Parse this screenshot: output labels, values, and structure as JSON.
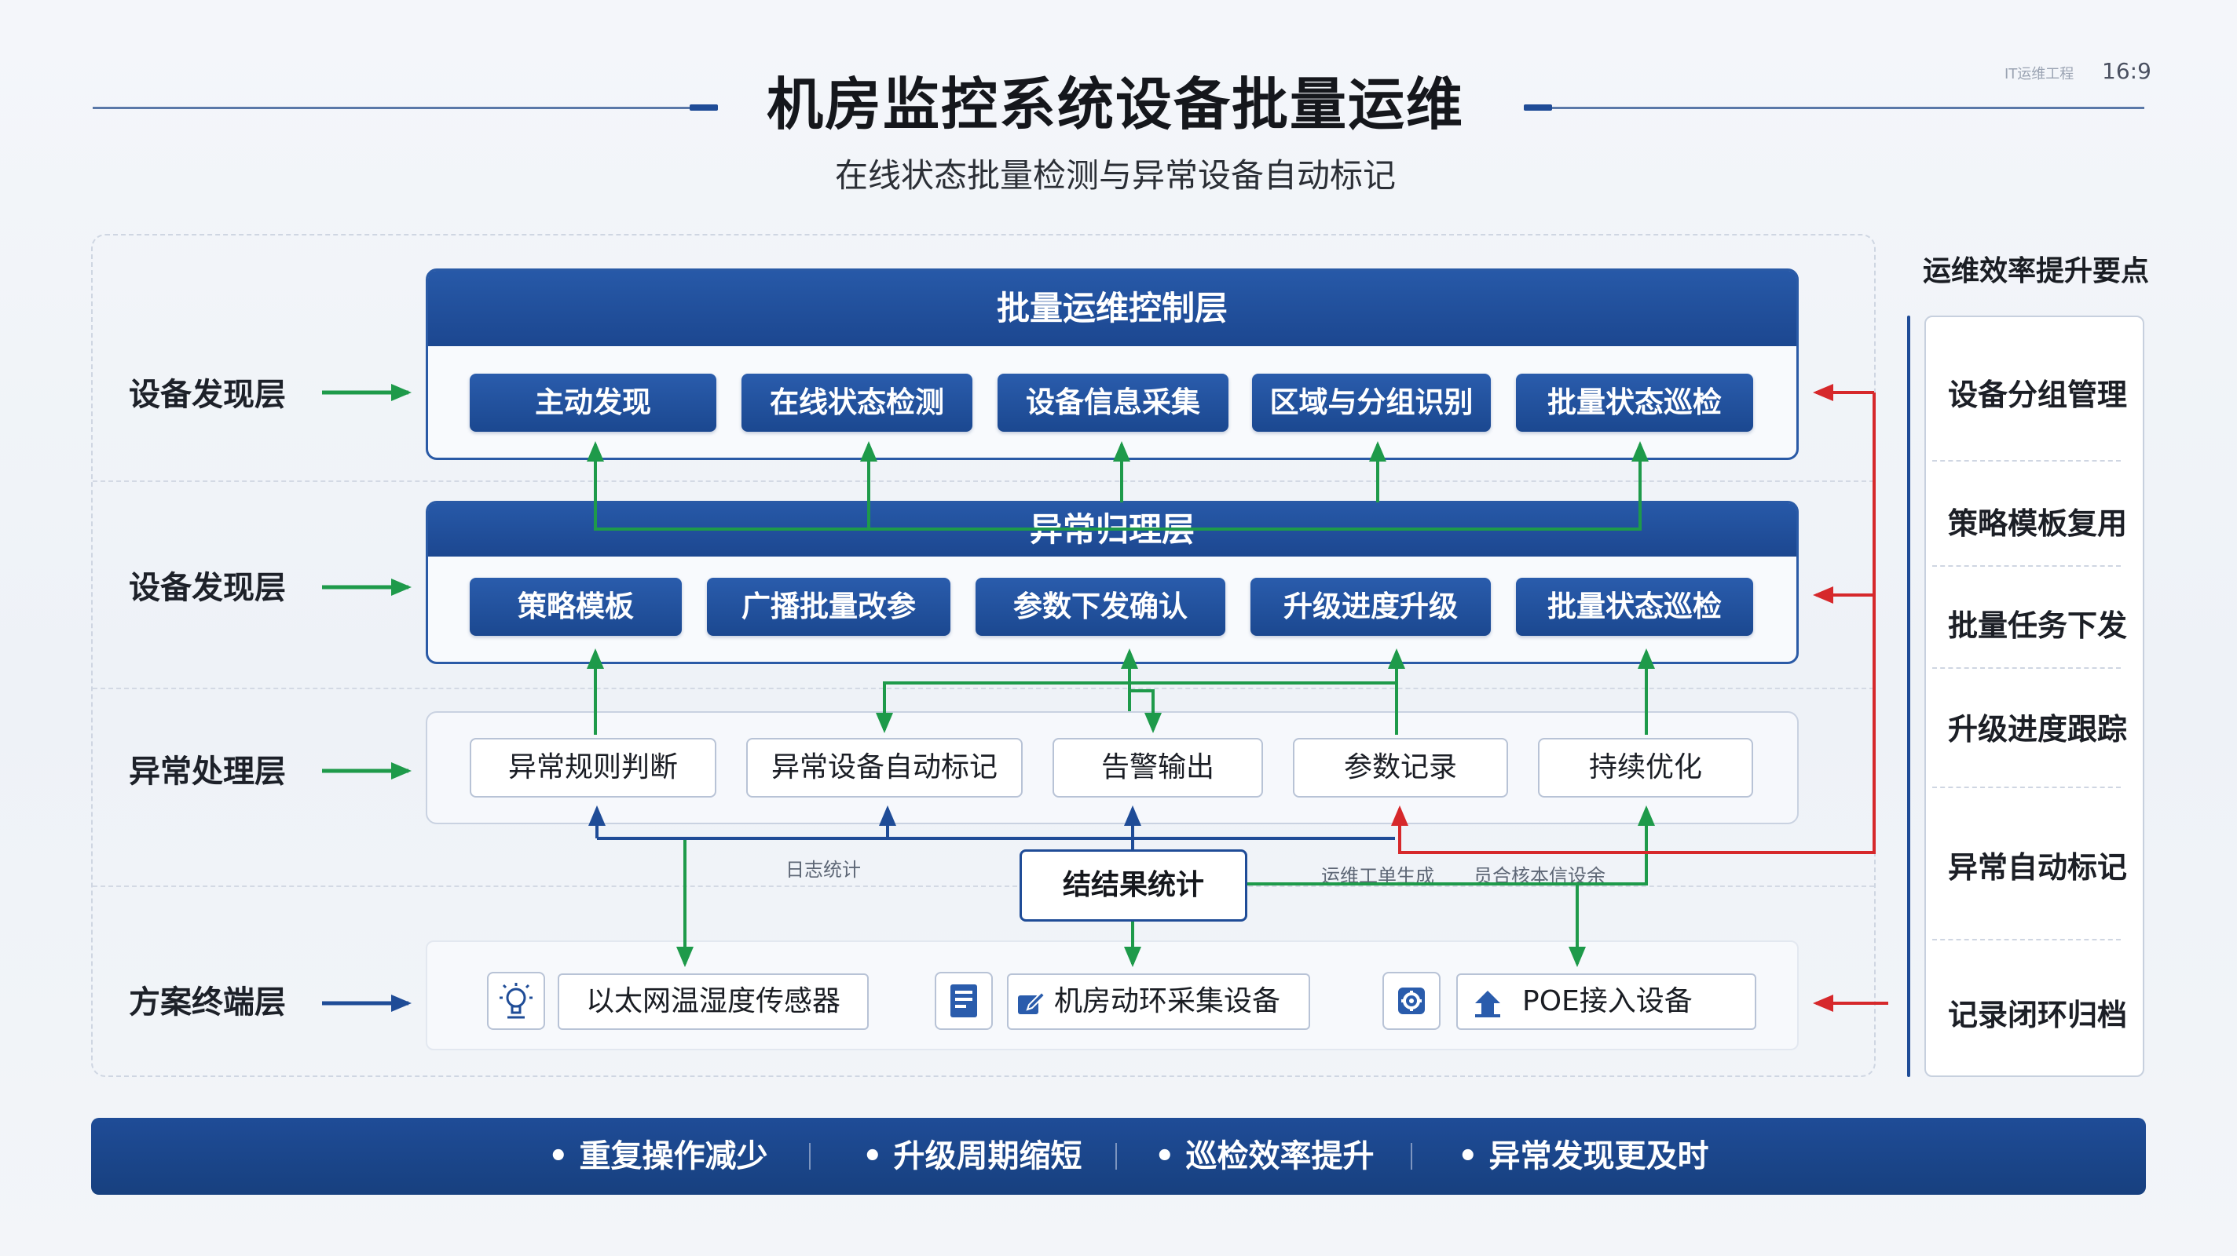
{
  "header": {
    "title": "机房监控系统设备批量运维",
    "subtitle": "在线状态批量检测与异常设备自动标记",
    "corner_label": "IT运维工程",
    "aspect_ratio": "16:9"
  },
  "layers": [
    {
      "label": "设备发现层",
      "arrow_color": "#1e9a4a"
    },
    {
      "label": "设备发现层",
      "arrow_color": "#1e9a4a"
    },
    {
      "label": "异常处理层",
      "arrow_color": "#1e9a4a"
    },
    {
      "label": "方案终端层",
      "arrow_color": "#1f4c97"
    }
  ],
  "control_layer": {
    "title": "批量运维控制层",
    "items": [
      "主动发现",
      "在线状态检测",
      "设备信息采集",
      "区域与分组识别",
      "批量状态巡检"
    ]
  },
  "anomaly_layer": {
    "title": "异常归理层",
    "items": [
      "策略模板",
      "广播批量改参",
      "参数下发确认",
      "升级进度升级",
      "批量状态巡检"
    ]
  },
  "processing_layer": {
    "items": [
      "异常规则判断",
      "异常设备自动标记",
      "告警输出",
      "参数记录",
      "持续优化"
    ]
  },
  "stats": {
    "label": "结结果统计",
    "note_left": "日志统计",
    "note_right_1": "运维工单生成",
    "note_right_2": "员合核本信设余"
  },
  "devices": [
    {
      "icon": "bulb-sensor-icon",
      "label": "以太网温湿度传感器"
    },
    {
      "icon": "clipboard-device-icon",
      "label": "机房动环采集设备"
    },
    {
      "icon": "gear-icon",
      "label": "POE接入设备"
    }
  ],
  "sidebar": {
    "title": "运维效率提升要点",
    "items": [
      "设备分组管理",
      "策略模板复用",
      "批量任务下发",
      "升级进度跟踪",
      "异常自动标记",
      "记录闭环归档"
    ]
  },
  "footer": {
    "items": [
      "重复操作减少",
      "升级周期缩短",
      "巡检效率提升",
      "异常发现更及时"
    ]
  },
  "colors": {
    "primary_blue": "#1f4c97",
    "flow_green": "#1e9a4a",
    "feedback_red": "#d6282b"
  }
}
